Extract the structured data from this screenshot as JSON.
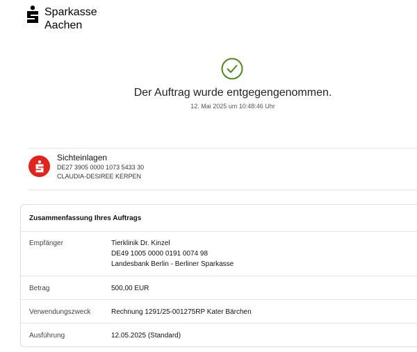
{
  "brand": {
    "line1": "Sparkasse",
    "line2": "Aachen"
  },
  "status": {
    "title": "Der Auftrag wurde entgegengenommen.",
    "timestamp": "12. Mai 2025 um 10:48:46 Uhr",
    "icon": "check-circle-icon",
    "color": "#4a8a1c"
  },
  "account": {
    "name": "Sichteinlagen",
    "iban": "DE27 3905 0000 1073 5433 30",
    "owner": "CLAUDIA-DESIREE KERPEN",
    "icon": "sparkasse-s-icon",
    "color": "#e2231a"
  },
  "summary": {
    "title": "Zusammenfassung Ihres Auftrags",
    "recipient_label": "Empfänger",
    "recipient_name": "Tierklinik Dr. Kinzel",
    "recipient_iban": "DE49 1005 0000 0191 0074 98",
    "recipient_bank": "Landesbank Berlin - Berliner Sparkasse",
    "amount_label": "Betrag",
    "amount_value": "500,00 EUR",
    "purpose_label": "Verwendungszweck",
    "purpose_value": "Rechnung 1291/25-001275RP Kater Bärchen",
    "execution_label": "Ausführung",
    "execution_value": "12.05.2025 (Standard)"
  }
}
